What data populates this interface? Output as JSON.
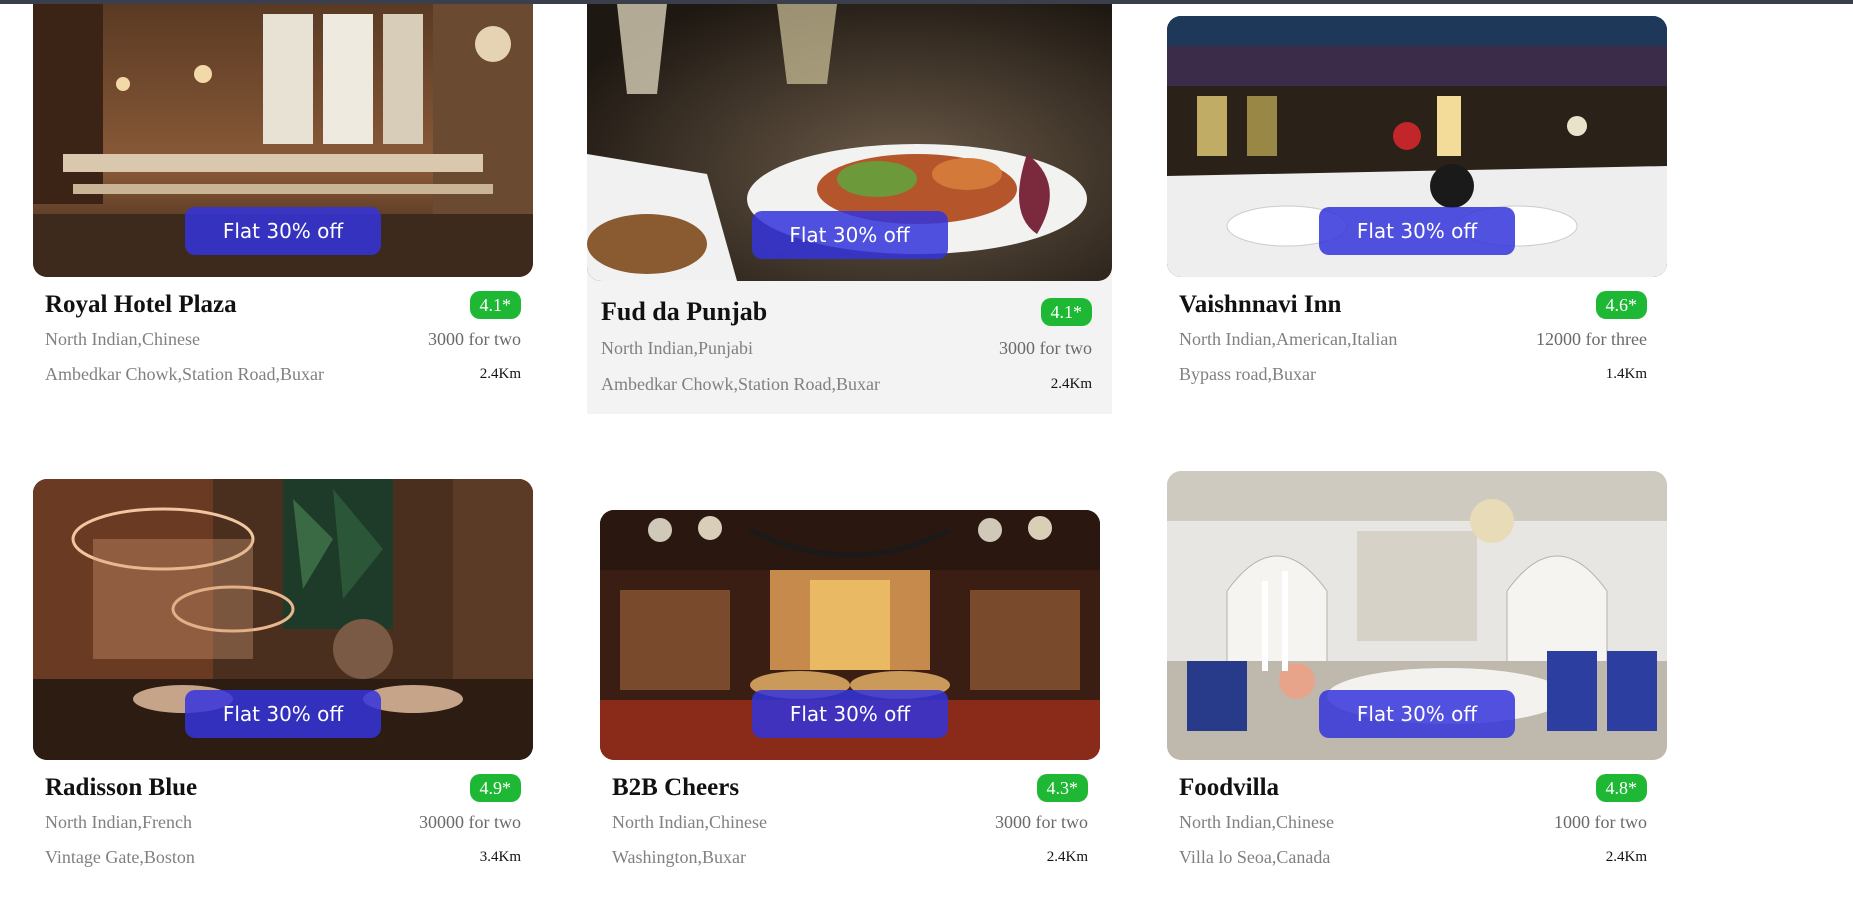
{
  "offer_label": "Flat 30% off",
  "colors": {
    "offer_badge": "#3434dc",
    "rating_badge": "#1fb835",
    "top_bar": "#3a3f4b"
  },
  "restaurants": [
    {
      "name": "Royal Hotel Plaza",
      "rating": "4.1*",
      "cuisine": "North Indian,Chinese",
      "price": "3000 for two",
      "address": "Ambedkar Chowk,Station Road,Buxar",
      "distance": "2.4Km",
      "image": "restaurant-interior-photo"
    },
    {
      "name": "Fud da Punjab",
      "rating": "4.1*",
      "cuisine": "North Indian,Punjabi",
      "price": "3000 for two",
      "address": "Ambedkar Chowk,Station Road,Buxar",
      "distance": "2.4Km",
      "image": "plated-food-photo"
    },
    {
      "name": "Vaishnnavi Inn",
      "rating": "4.6*",
      "cuisine": "North Indian,American,Italian",
      "price": "12000 for three",
      "address": "Bypass road,Buxar",
      "distance": "1.4Km",
      "image": "candlelit-dinner-photo"
    },
    {
      "name": "Radisson Blue",
      "rating": "4.9*",
      "cuisine": "North Indian,French",
      "price": "30000 for two",
      "address": "Vintage Gate,Boston",
      "distance": "3.4Km",
      "image": "lounge-interior-photo"
    },
    {
      "name": "B2B Cheers",
      "rating": "4.3*",
      "cuisine": "North Indian,Chinese",
      "price": "3000 for two",
      "address": "Washington,Buxar",
      "distance": "2.4Km",
      "image": "bar-interior-photo"
    },
    {
      "name": "Foodvilla",
      "rating": "4.8*",
      "cuisine": "North Indian,Chinese",
      "price": "1000 for two",
      "address": "Villa lo Seoa,Canada",
      "distance": "2.4Km",
      "image": "banquet-hall-photo"
    }
  ]
}
